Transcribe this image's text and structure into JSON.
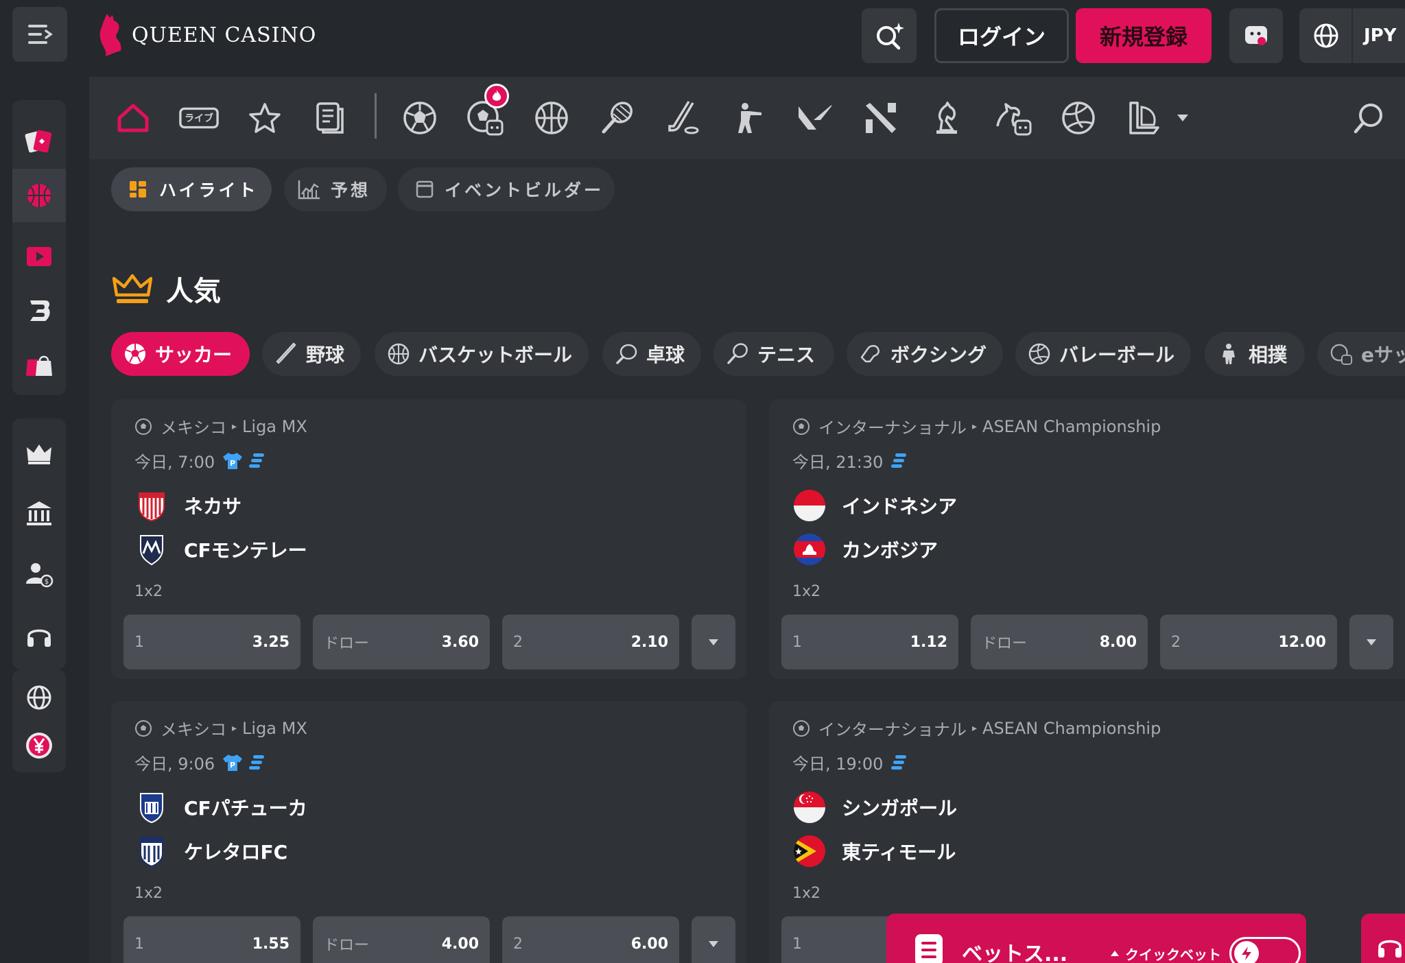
{
  "header": {
    "brand": "QUEEN CASINO",
    "login_label": "ログイン",
    "register_label": "新規登録",
    "currency": "JPY"
  },
  "colors": {
    "accent": "#e0115a",
    "background": "#2a2d31",
    "card": "#2f3237",
    "odds_button": "#4b4e54",
    "crown": "#f4a017",
    "info_blue": "#3fa3f5"
  },
  "sports_bar": {
    "icons": [
      "home-icon",
      "live-icon",
      "star-icon",
      "betslip-icon",
      "soccer-icon",
      "soccer-bot-icon",
      "basketball-icon",
      "tennis-icon",
      "hockey-icon",
      "counter-strike-icon",
      "valorant-icon",
      "dota-icon",
      "chess-icon",
      "horse-bot-icon",
      "volleyball-icon",
      "league-of-legends-icon"
    ],
    "live_label": "ライブ",
    "badge": "hot"
  },
  "view_tabs": [
    {
      "label": "ハイライト",
      "active": true
    },
    {
      "label": "予想",
      "active": false
    },
    {
      "label": "イベントビルダー",
      "active": false
    }
  ],
  "section_title": "人気",
  "sport_filters": [
    {
      "label": "サッカー",
      "active": true
    },
    {
      "label": "野球"
    },
    {
      "label": "バスケットボール"
    },
    {
      "label": "卓球"
    },
    {
      "label": "テニス"
    },
    {
      "label": "ボクシング"
    },
    {
      "label": "バレーボール"
    },
    {
      "label": "相撲"
    },
    {
      "label": "eサッ"
    }
  ],
  "matches": [
    {
      "country": "メキシコ",
      "league": "Liga MX",
      "time": "今日, 7:00",
      "home": "ネカサ",
      "away": "CFモンテレー",
      "market": "1x2",
      "odds": [
        {
          "label": "1",
          "value": "3.25"
        },
        {
          "label": "ドロー",
          "value": "3.60"
        },
        {
          "label": "2",
          "value": "2.10"
        }
      ]
    },
    {
      "country": "インターナショナル",
      "league": "ASEAN Championship",
      "time": "今日, 21:30",
      "home": "インドネシア",
      "away": "カンボジア",
      "market": "1x2",
      "odds": [
        {
          "label": "1",
          "value": "1.12"
        },
        {
          "label": "ドロー",
          "value": "8.00"
        },
        {
          "label": "2",
          "value": "12.00"
        }
      ]
    },
    {
      "country": "メキシコ",
      "league": "Liga MX",
      "time": "今日, 9:06",
      "home": "CFパチューカ",
      "away": "ケレタロFC",
      "market": "1x2",
      "odds": [
        {
          "label": "1",
          "value": "1.55"
        },
        {
          "label": "ドロー",
          "value": "4.00"
        },
        {
          "label": "2",
          "value": "6.00"
        }
      ]
    },
    {
      "country": "インターナショナル",
      "league": "ASEAN Championship",
      "time": "今日, 19:00",
      "home": "シンガポール",
      "away": "東ティモール",
      "market": "1x2",
      "odds": [
        {
          "label": "1",
          "value": ""
        }
      ]
    }
  ],
  "betslip": {
    "label": "ベットス...",
    "quickbet_label": "クイックベット"
  }
}
